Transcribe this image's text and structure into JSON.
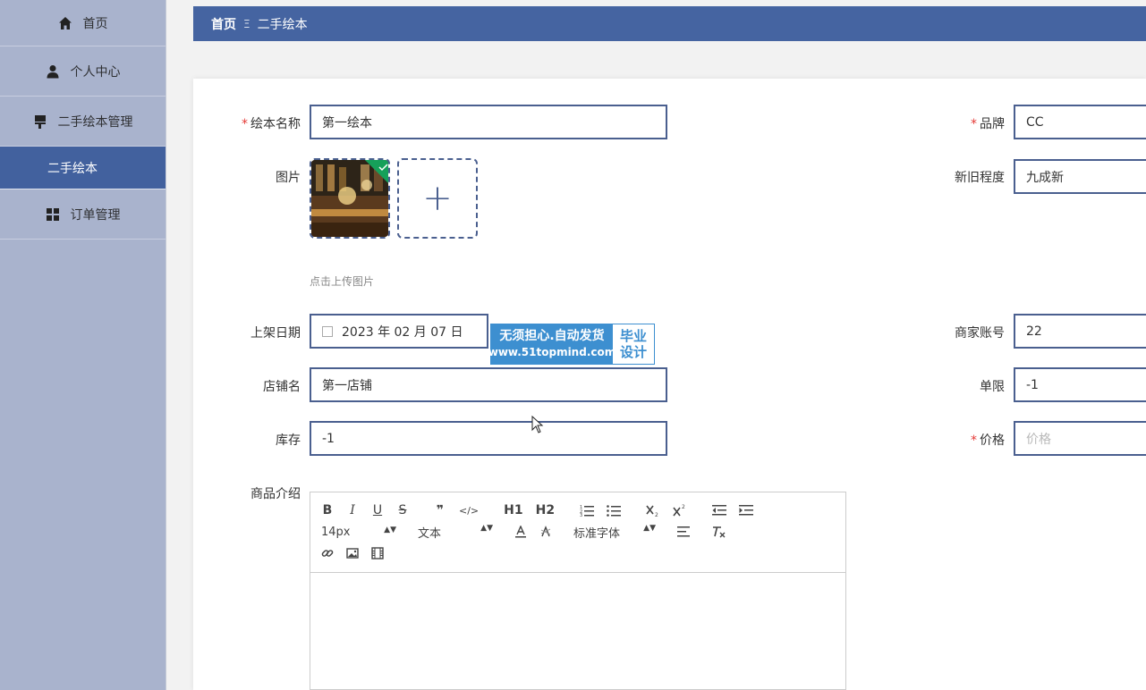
{
  "sidebar": {
    "items": [
      {
        "label": "首页",
        "icon": "home-icon"
      },
      {
        "label": "个人中心",
        "icon": "user-icon"
      },
      {
        "label": "二手绘本管理",
        "icon": "stamp-icon"
      },
      {
        "label": "二手绘本",
        "icon": ""
      },
      {
        "label": "订单管理",
        "icon": "grid-icon"
      }
    ]
  },
  "topbar": {
    "home": "首页",
    "separator": "Ξ",
    "current": "二手绘本"
  },
  "form": {
    "name_label": "绘本名称",
    "name_value": "第一绘本",
    "brand_label": "品牌",
    "brand_value": "CC",
    "image_label": "图片",
    "image_hint": "点击上传图片",
    "condition_label": "新旧程度",
    "condition_value": "九成新",
    "date_label": "上架日期",
    "date_value": "2023 年 02 月 07 日",
    "merchant_label": "商家账号",
    "merchant_value": "22",
    "shop_label": "店铺名",
    "shop_value": "第一店铺",
    "limit_label": "单限",
    "limit_value": "-1",
    "stock_label": "库存",
    "stock_value": "-1",
    "price_label": "价格",
    "price_placeholder": "价格",
    "intro_label": "商品介绍",
    "required_mark": "*"
  },
  "watermark": {
    "line1": "无须担心.自动发货",
    "line2": "www.51topmind.com",
    "side1": "毕业",
    "side2": "设计"
  },
  "editor": {
    "font_size": "14px",
    "paragraph": "文本",
    "font_family": "标准字体",
    "buttons": [
      "B",
      "I",
      "U",
      "S",
      "❞",
      "</>",
      "H1",
      "H2"
    ]
  },
  "colors": {
    "sidebar_bg": "#a9b3cd",
    "accent": "#4564a1",
    "required": "#e53935"
  }
}
